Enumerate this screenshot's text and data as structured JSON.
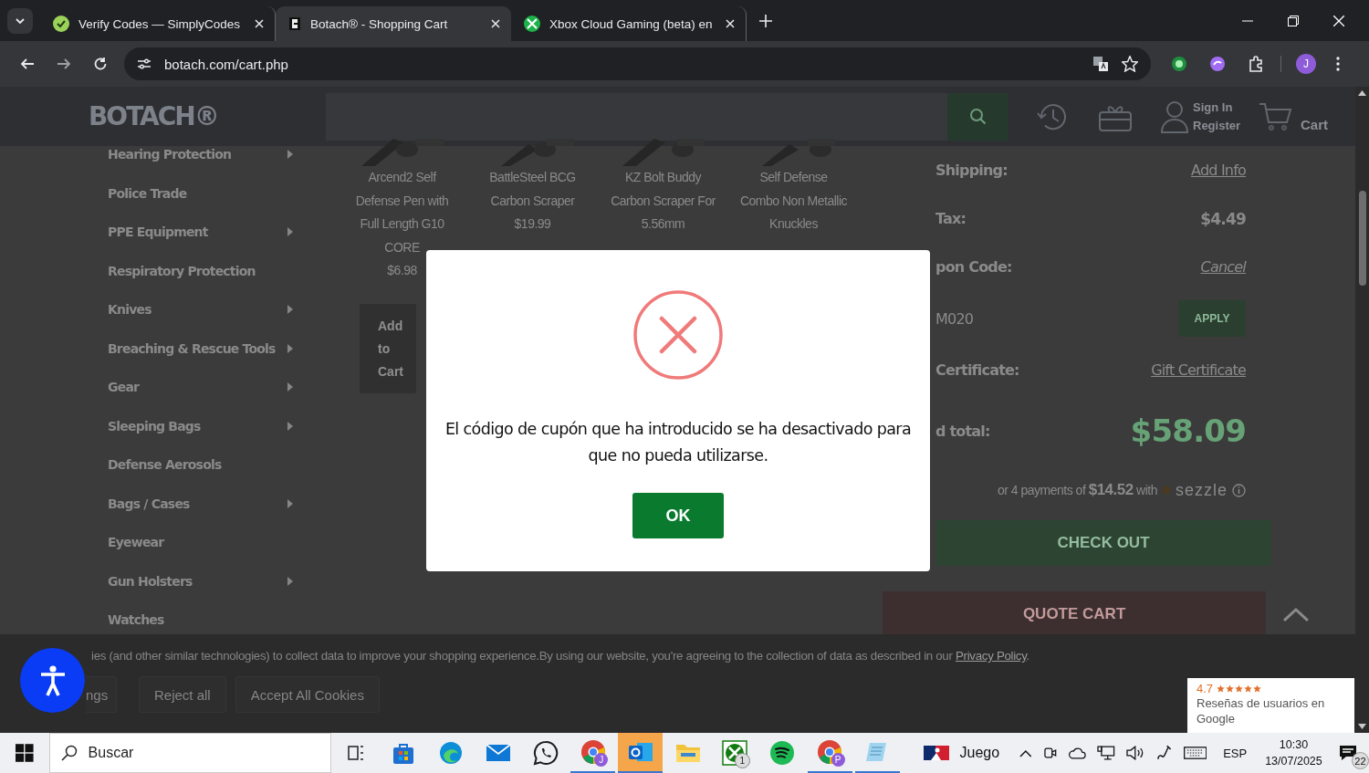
{
  "browser": {
    "tabs": [
      {
        "title": "Verify Codes — SimplyCodes",
        "kind": "simplycodes",
        "selected": false
      },
      {
        "title": "Botach® - Shopping Cart",
        "kind": "botach",
        "selected": true
      },
      {
        "title": "Xbox Cloud Gaming (beta) en",
        "kind": "xbox",
        "selected": false
      }
    ],
    "url": "botach.com/cart.php",
    "profile": "J"
  },
  "site": {
    "logo": "BOTACH®",
    "sign_in": "Sign In",
    "register": "Register",
    "cart": "Cart",
    "sidebar": [
      {
        "label": "Hearing Protection",
        "has_submenu": true
      },
      {
        "label": "Police Trade",
        "has_submenu": false
      },
      {
        "label": "PPE Equipment",
        "has_submenu": true
      },
      {
        "label": "Respiratory Protection",
        "has_submenu": false
      },
      {
        "label": "Knives",
        "has_submenu": true
      },
      {
        "label": "Breaching & Rescue Tools",
        "has_submenu": true
      },
      {
        "label": "Gear",
        "has_submenu": true
      },
      {
        "label": "Sleeping Bags",
        "has_submenu": true
      },
      {
        "label": "Defense Aerosols",
        "has_submenu": false
      },
      {
        "label": "Bags / Cases",
        "has_submenu": true
      },
      {
        "label": "Eyewear",
        "has_submenu": false
      },
      {
        "label": "Gun Holsters",
        "has_submenu": true
      },
      {
        "label": "Watches",
        "has_submenu": false
      }
    ],
    "products": [
      {
        "name": "Arcend2 Self Defense Pen with Full Length G10 CORE",
        "price": "$6.98",
        "button": "Add to Cart"
      },
      {
        "name": "BattleSteel BCG Carbon Scraper",
        "price": "$19.99"
      },
      {
        "name": "KZ Bolt Buddy Carbon Scraper For 5.56mm"
      },
      {
        "name": "Self Defense Combo Non Metallic Knuckles"
      }
    ],
    "summary": [
      {
        "label": "Shipping:",
        "value": "Add Info",
        "kind": "link"
      },
      {
        "label": "Tax:",
        "value": "$4.49",
        "kind": "amount"
      },
      {
        "label": "pon Code:",
        "value": "Cancel",
        "kind": "italic-link"
      },
      {
        "kind": "coupon",
        "value": "M020",
        "button": "APPLY"
      },
      {
        "label": "Certificate:",
        "value": "Gift Certificate",
        "kind": "link"
      },
      {
        "label": "d total:",
        "value": "$58.09",
        "kind": "total"
      }
    ],
    "installments": "or 4 payments of **$14.52** with",
    "sezzle": "sezzle",
    "checkout": "CHECK OUT",
    "quote": "QUOTE CART"
  },
  "modal": {
    "message": "El código de cupón que ha introducido se ha desactivado para que no pueda utilizarse.",
    "button": "OK"
  },
  "cookie_banner": {
    "text": "ies (and other similar technologies) to collect data to improve your shopping experience.By using our website, you're agreeing to the collection of data as described in our",
    "link": "Privacy Policy",
    "tail": ".",
    "buttons": [
      "ngs",
      "Reject all",
      "Accept All Cookies"
    ]
  },
  "reviews": {
    "rating": "4.7",
    "stars": 5,
    "text": "Reseñas de usuarios en Google"
  },
  "taskbar": {
    "search": "Buscar",
    "apps": [
      {
        "kind": "taskview",
        "running": false,
        "selected": false
      },
      {
        "kind": "store",
        "running": false,
        "selected": false
      },
      {
        "kind": "edge",
        "running": false,
        "selected": false
      },
      {
        "kind": "mail",
        "running": false,
        "selected": false
      },
      {
        "kind": "whatsapp",
        "running": false,
        "selected": false
      },
      {
        "kind": "chrome",
        "badge": "J",
        "running": true,
        "selected": false
      },
      {
        "kind": "outlook",
        "running": true,
        "selected": true
      },
      {
        "kind": "explorer",
        "running": false,
        "selected": false
      },
      {
        "kind": "xbox",
        "badge": "1",
        "running": false,
        "selected": false
      },
      {
        "kind": "spotify",
        "running": false,
        "selected": false
      },
      {
        "kind": "chrome",
        "badge": "P",
        "running": true,
        "selected": false
      },
      {
        "kind": "notepad",
        "running": true,
        "selected": false
      }
    ],
    "game": "Juego",
    "language": "ESP",
    "time": "10:30",
    "date": "13/07/2025",
    "notifications": "22"
  }
}
